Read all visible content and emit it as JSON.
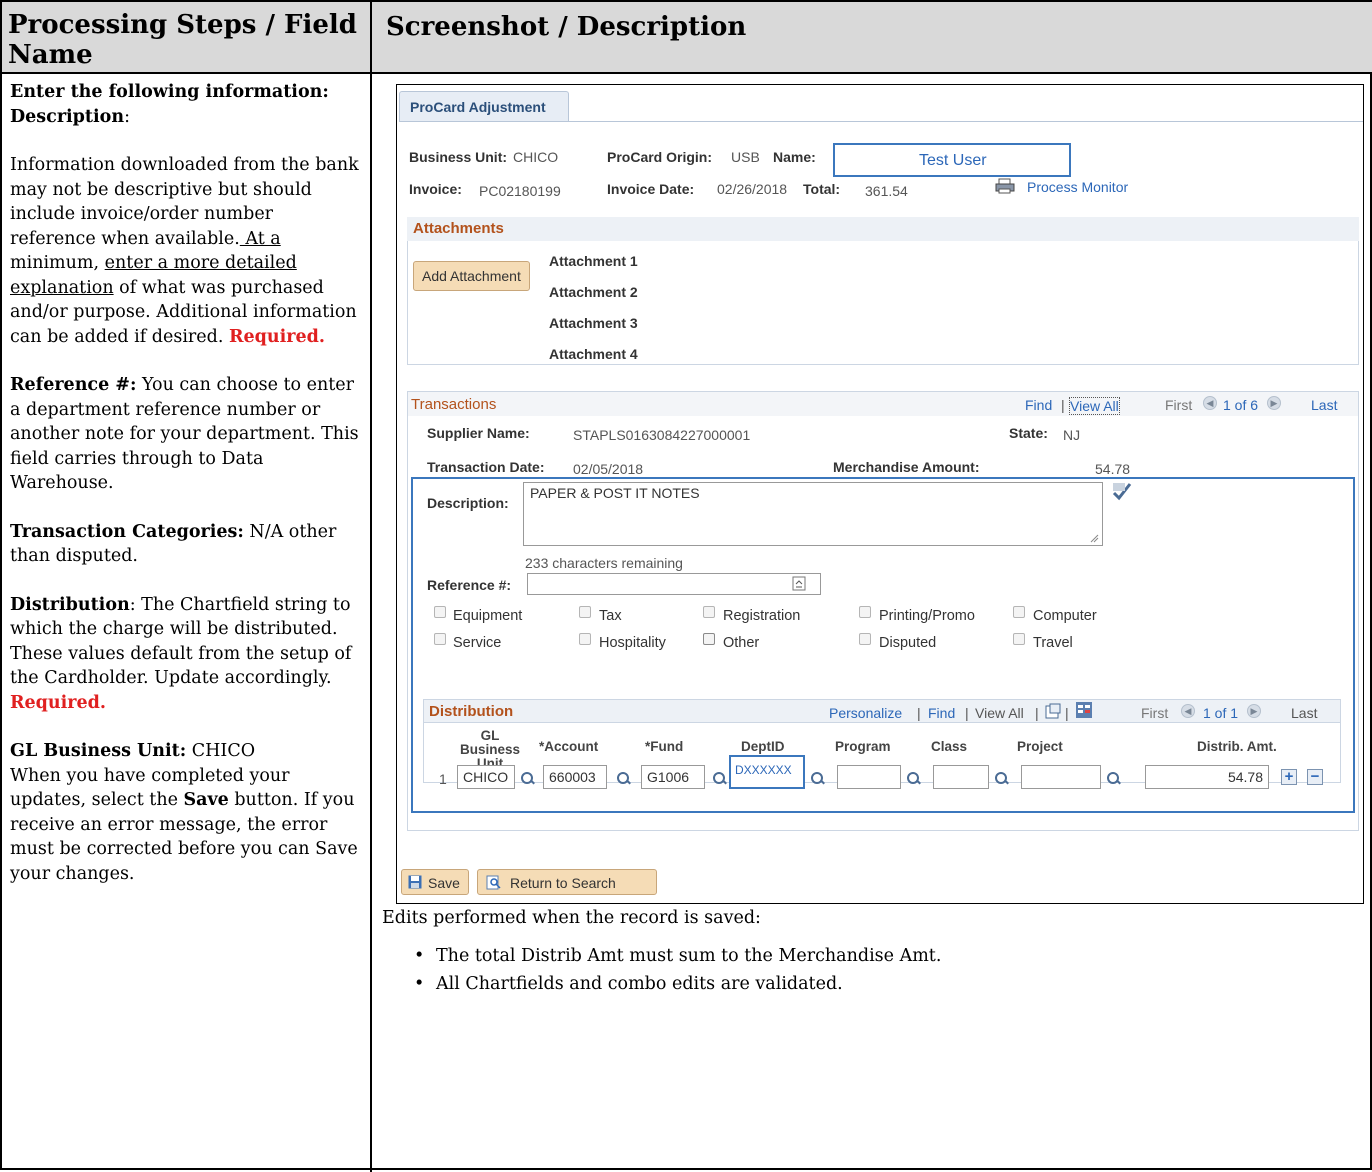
{
  "headers": {
    "left": "Processing Steps / Field Name",
    "right": "Screenshot / Description"
  },
  "left": {
    "intro1": "Enter the following information:",
    "desc_label": "Description",
    "desc_colon": ":",
    "desc_text_1": "Information downloaded from the bank may not be descriptive but should include invoice/order number reference when available.",
    "desc_text_u1": " At a",
    "desc_text_2": " minimum,",
    "desc_text_u2": "enter a more detailed explanation",
    "desc_text_3": " of what was purchased and/or purpose. Additional information can be added if desired.",
    "required1": "Required.",
    "ref_label": "Reference #:",
    "ref_text": " You can choose to enter a department reference number or another note for your department. This field carries through to Data Warehouse.",
    "cat_label": "Transaction Categories:",
    "cat_text": " N/A other than disputed.",
    "dist_label": "Distribution",
    "dist_text": ": The Chartfield string to which the charge will be distributed. These values default from the setup of the Cardholder. Update accordingly.",
    "required2": "Required.",
    "gl_label": "GL Business Unit:",
    "gl_text": " CHICO",
    "save_text_1": "When you have completed your updates, select the ",
    "save_word": "Save",
    "save_text_2": " button.  If you receive an error message, the error must be corrected before you can Save your changes."
  },
  "screenshot": {
    "tab": "ProCard Adjustment",
    "business_unit_label": "Business Unit:",
    "business_unit": "CHICO",
    "origin_label": "ProCard Origin:",
    "origin": "USB",
    "name_label": "Name:",
    "name": "Test User",
    "invoice_label": "Invoice:",
    "invoice": "PC02180199",
    "invoice_date_label": "Invoice Date:",
    "invoice_date": "02/26/2018",
    "total_label": "Total:",
    "total": "361.54",
    "process_monitor": "Process Monitor",
    "attachments_title": "Attachments",
    "add_attachment": "Add Attachment",
    "attachments": [
      "Attachment 1",
      "Attachment 2",
      "Attachment 3",
      "Attachment 4"
    ],
    "transactions_title": "Transactions",
    "find": "Find",
    "view_all": "View All",
    "first": "First",
    "page_of": "1 of 6",
    "last": "Last",
    "supplier_label": "Supplier Name:",
    "supplier": "STAPLS0163084227000001",
    "state_label": "State:",
    "state": "NJ",
    "trans_date_label": "Transaction Date:",
    "trans_date": "02/05/2018",
    "merch_label": "Merchandise Amount:",
    "merch": "54.78",
    "description_label": "Description:",
    "description": "PAPER & POST IT NOTES",
    "chars_remaining": "233 characters remaining",
    "reference_label": "Reference #:",
    "categories": [
      "Equipment",
      "Tax",
      "Registration",
      "Printing/Promo",
      "Computer",
      "Service",
      "Hospitality",
      "Other",
      "Disputed",
      "Travel"
    ],
    "distribution_title": "Distribution",
    "dist_personalize": "Personalize",
    "dist_find": "Find",
    "dist_view_all": "View All",
    "dist_first": "First",
    "dist_page_of": "1 of 1",
    "dist_last": "Last",
    "col_gl": "GL Business Unit",
    "col_account": "*Account",
    "col_fund": "*Fund",
    "col_dept": "DeptID",
    "col_program": "Program",
    "col_class": "Class",
    "col_project": "Project",
    "col_amt": "Distrib. Amt.",
    "row_num": "1",
    "row_gl": "CHICO",
    "row_account": "660003",
    "row_fund": "G1006",
    "row_dept": "DXXXXXX",
    "row_amt": "54.78",
    "save": "Save",
    "return_to_search": "Return to Search"
  },
  "edits": {
    "intro": "Edits performed when the record is saved:",
    "bullets": [
      "The total Distrib Amt must sum to the Merchandise Amt.",
      "All Chartfields and combo edits are validated."
    ]
  },
  "colors": {
    "header_bg": "#d9d9d9",
    "required": "#e02020",
    "ps_blue": "#2c67b8",
    "ps_orange": "#b3521c"
  }
}
